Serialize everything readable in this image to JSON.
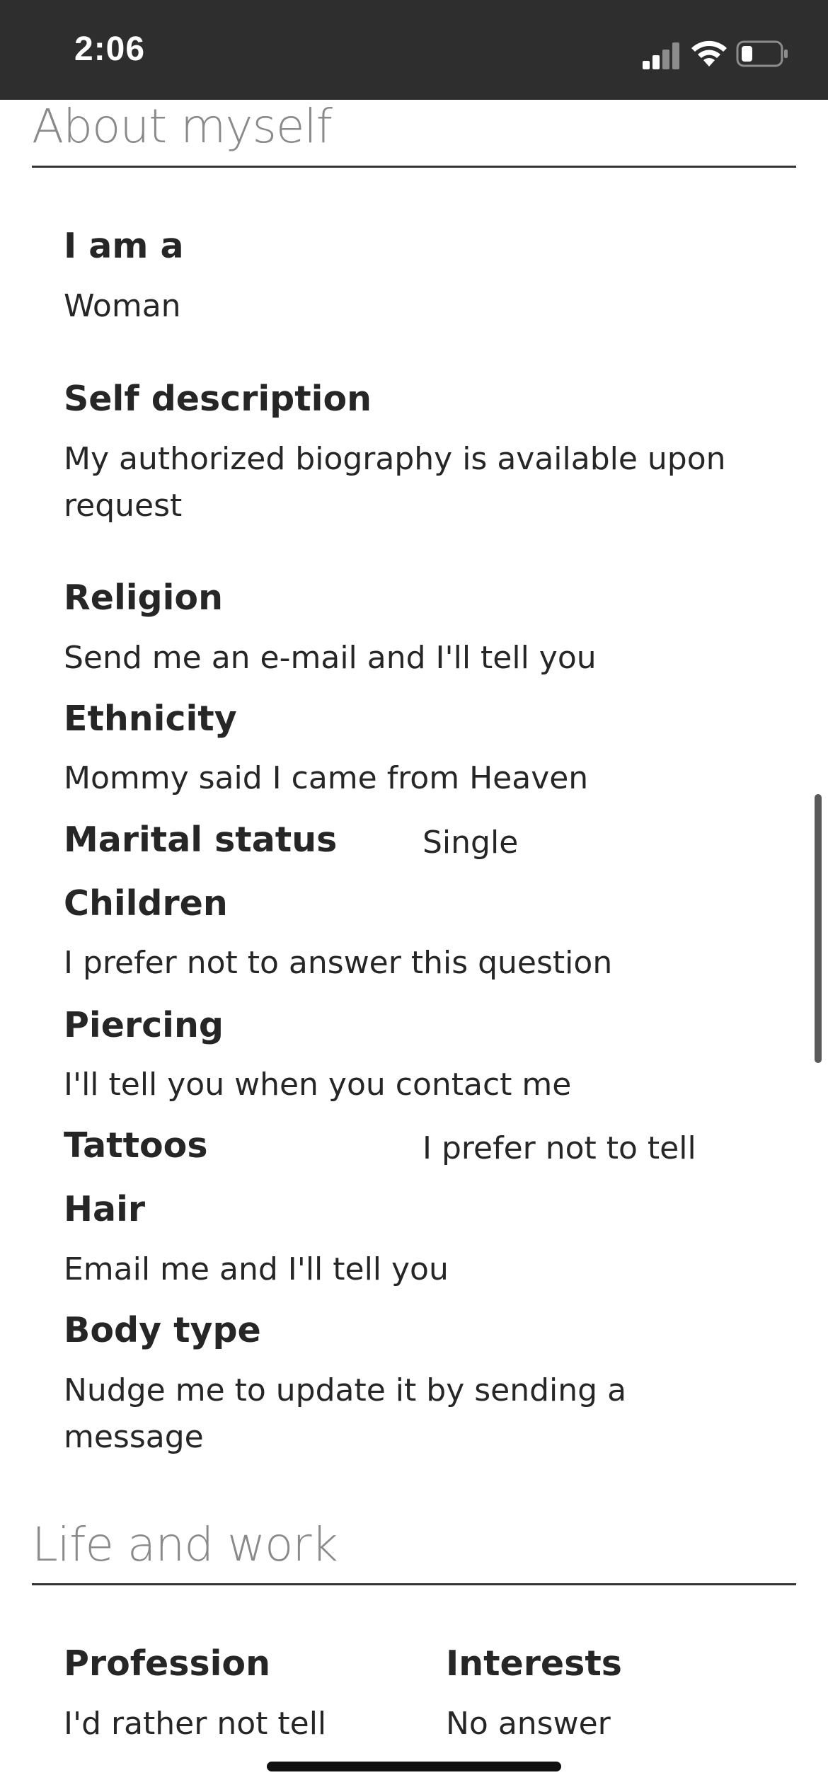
{
  "status_bar": {
    "time": "2:06",
    "icons": [
      "signal-icon",
      "wifi-icon",
      "battery-icon"
    ]
  },
  "about": {
    "title": "About myself",
    "fields": {
      "iam_label": "I am a",
      "iam_value": "Woman",
      "self_label": "Self description",
      "self_value": "My authorized biography is available upon request",
      "religion_label": "Religion",
      "religion_value": "Send me an e-mail and I'll tell you",
      "ethnicity_label": "Ethnicity",
      "ethnicity_value": "Mommy said I came from Heaven",
      "marital_label": "Marital status",
      "marital_value": "Single",
      "children_label": "Children",
      "children_value": "I prefer not to answer this question",
      "piercing_label": "Piercing",
      "piercing_value": "I'll tell you when you contact me",
      "tattoos_label": "Tattoos",
      "tattoos_value": "I prefer not to tell",
      "hair_label": "Hair",
      "hair_value": "Email me and I'll tell you",
      "body_label": "Body type",
      "body_value": "Nudge me to update it by sending a message"
    }
  },
  "life": {
    "title": "Life and work",
    "profession_label": "Profession",
    "profession_value": "I'd rather not tell",
    "interests_label": "Interests",
    "interests_value": "No answer"
  },
  "colors": {
    "status_bar_bg": "#2e2e2e",
    "section_title": "#8a8a8a",
    "text": "#262626"
  }
}
